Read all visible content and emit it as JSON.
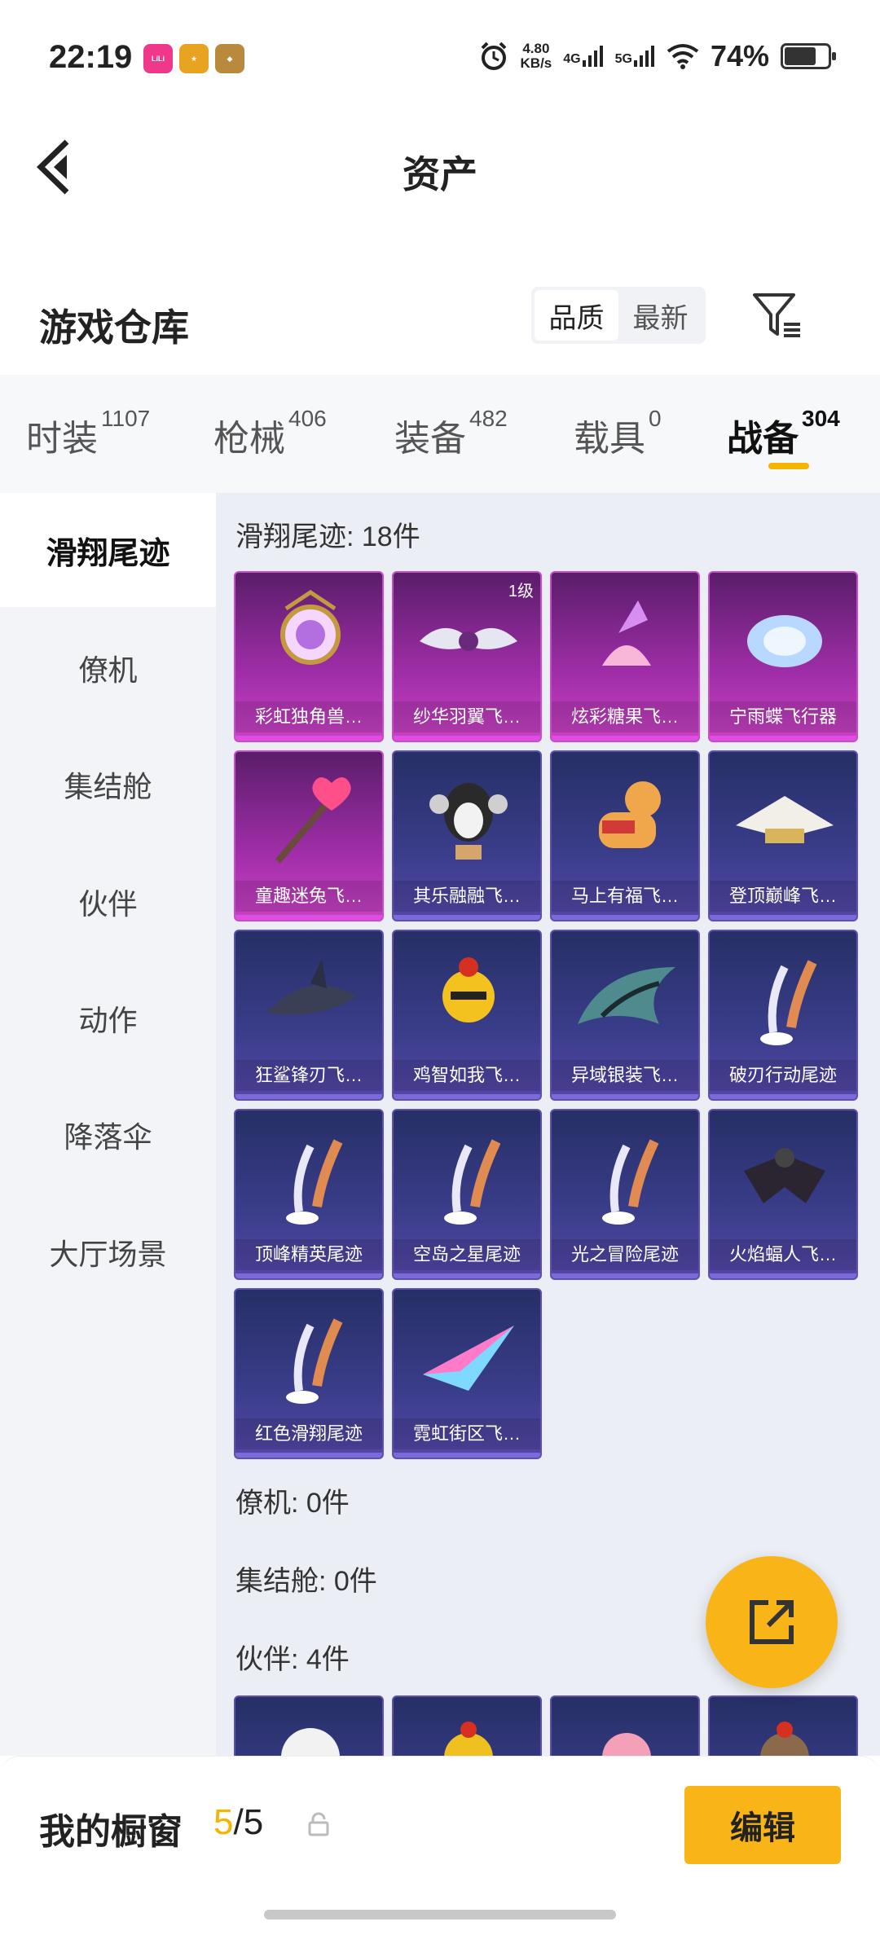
{
  "status_bar": {
    "time": "22:19",
    "speed_value": "4.80",
    "speed_unit": "KB/s",
    "net1": "4G",
    "net2": "5G",
    "battery": "74%",
    "battery_level": 0.74
  },
  "header": {
    "title": "资产"
  },
  "section": {
    "title": "游戏仓库",
    "sort_options": [
      "品质",
      "最新"
    ],
    "sort_active": "品质"
  },
  "tabs": [
    {
      "label": "时装",
      "count": "1107"
    },
    {
      "label": "枪械",
      "count": "406"
    },
    {
      "label": "装备",
      "count": "482"
    },
    {
      "label": "载具",
      "count": "0"
    },
    {
      "label": "战备",
      "count": "304",
      "active": true
    }
  ],
  "sidebar": {
    "items": [
      "滑翔尾迹",
      "僚机",
      "集结舱",
      "伙伴",
      "动作",
      "降落伞",
      "大厅场景"
    ],
    "active": "滑翔尾迹"
  },
  "content": {
    "glide_title": "滑翔尾迹: 18件",
    "glide_items": [
      {
        "name": "彩虹独角兽…",
        "tier": "purple",
        "icon": "unicorn-icon"
      },
      {
        "name": "纱华羽翼飞…",
        "tier": "purple",
        "icon": "wing-icon",
        "badge": "1级"
      },
      {
        "name": "炫彩糖果飞…",
        "tier": "purple",
        "icon": "candy-icon"
      },
      {
        "name": "宁雨蝶飞行器",
        "tier": "purple",
        "icon": "butterfly-icon"
      },
      {
        "name": "童趣迷兔飞…",
        "tier": "purple",
        "icon": "wand-icon"
      },
      {
        "name": "其乐融融飞…",
        "tier": "blue",
        "icon": "penguin-icon"
      },
      {
        "name": "马上有福飞…",
        "tier": "blue",
        "icon": "horse-icon"
      },
      {
        "name": "登顶巅峰飞…",
        "tier": "blue",
        "icon": "jet-icon"
      },
      {
        "name": "狂鲨锋刃飞…",
        "tier": "blue",
        "icon": "shark-icon"
      },
      {
        "name": "鸡智如我飞…",
        "tier": "blue",
        "icon": "chicken-icon"
      },
      {
        "name": "异域银装飞…",
        "tier": "blue",
        "icon": "armor-wing-icon"
      },
      {
        "name": "破刃行动尾迹",
        "tier": "blue",
        "icon": "trail-icon"
      },
      {
        "name": "顶峰精英尾迹",
        "tier": "blue",
        "icon": "trail-icon"
      },
      {
        "name": "空岛之星尾迹",
        "tier": "blue",
        "icon": "trail-icon"
      },
      {
        "name": "光之冒险尾迹",
        "tier": "blue",
        "icon": "trail-icon"
      },
      {
        "name": "火焰蝠人飞…",
        "tier": "blue",
        "icon": "bat-suit-icon"
      },
      {
        "name": "红色滑翔尾迹",
        "tier": "blue",
        "icon": "trail-icon"
      },
      {
        "name": "霓虹街区飞…",
        "tier": "blue",
        "icon": "paper-plane-icon"
      }
    ],
    "wingman_title": "僚机: 0件",
    "pod_title": "集结舱: 0件",
    "partner_title": "伙伴: 4件"
  },
  "bottom": {
    "showcase_label": "我的橱窗",
    "showcase_current": "5",
    "showcase_sep_total": "/5",
    "edit_label": "编辑"
  },
  "colors": {
    "accent": "#f9b417",
    "purple_tier": "#c942c4",
    "blue_tier": "#5547a8"
  }
}
